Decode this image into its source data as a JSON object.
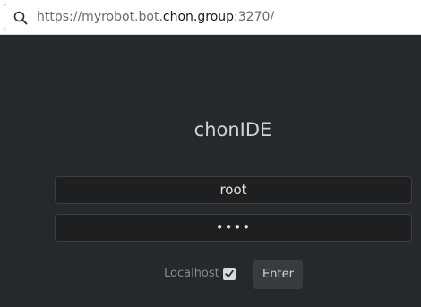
{
  "browser": {
    "url": {
      "prefix": "https://myrobot.bot.",
      "domain": "chon.group",
      "suffix": ":3270/"
    },
    "search_icon": "search-icon"
  },
  "login": {
    "title": "chonIDE",
    "username_value": "root",
    "password_masked": "••••",
    "localhost_label": "Localhost",
    "localhost_checked": true,
    "enter_label": "Enter"
  },
  "colors": {
    "background": "#26292b",
    "field_background": "#1d1f21",
    "button_background": "#383c3f"
  }
}
